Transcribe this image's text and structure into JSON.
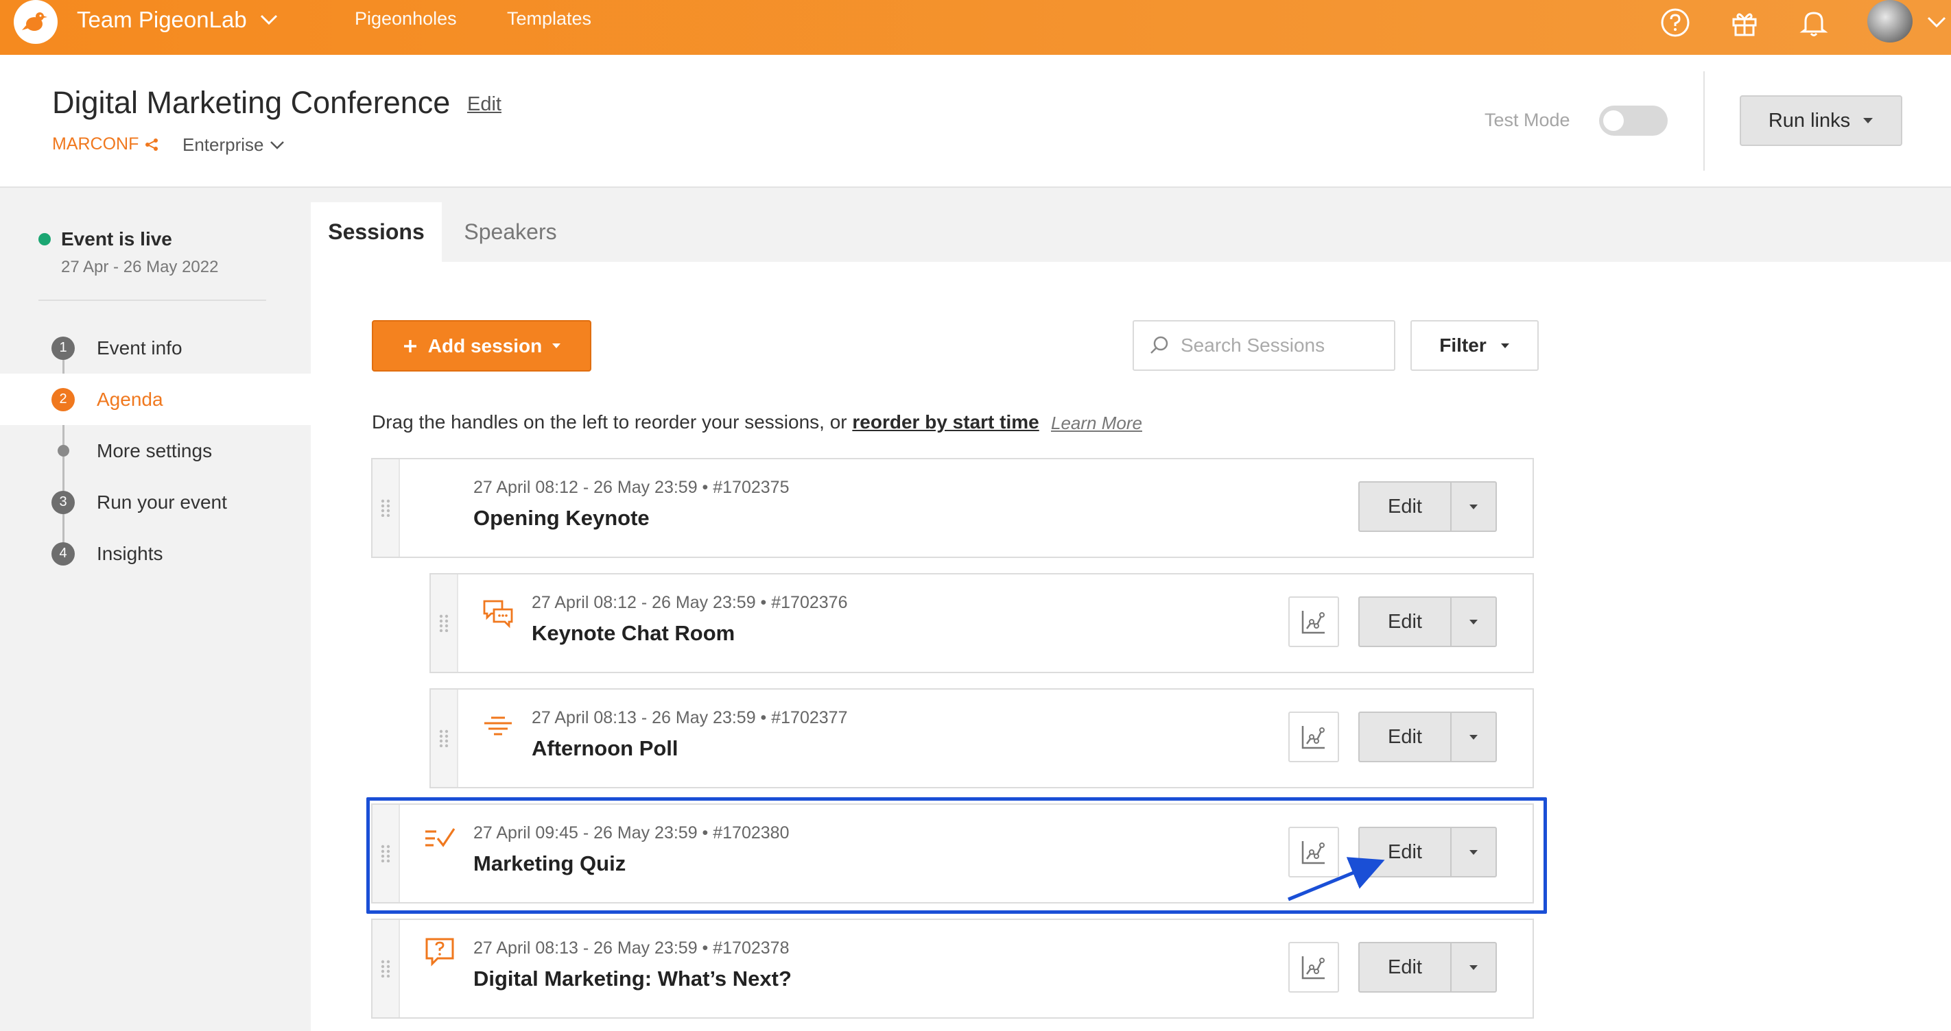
{
  "topbar": {
    "team_name": "Team PigeonLab",
    "nav": [
      "Pigeonholes",
      "Templates"
    ],
    "icons": [
      "help-icon",
      "gift-icon",
      "bell-icon"
    ]
  },
  "header": {
    "event_title": "Digital Marketing Conference",
    "edit_label": "Edit",
    "event_code": "MARCONF",
    "plan": "Enterprise",
    "test_mode_label": "Test Mode",
    "test_mode_on": false,
    "run_links_label": "Run links"
  },
  "sidebar": {
    "status": "Event is live",
    "dates": "27 Apr - 26 May 2022",
    "steps": [
      {
        "num": "1",
        "label": "Event info",
        "active": false
      },
      {
        "num": "2",
        "label": "Agenda",
        "active": true
      },
      {
        "num": "",
        "label": "More settings",
        "active": false
      },
      {
        "num": "3",
        "label": "Run your event",
        "active": false
      },
      {
        "num": "4",
        "label": "Insights",
        "active": false
      }
    ]
  },
  "tabs": [
    "Sessions",
    "Speakers"
  ],
  "toolbar": {
    "add_session": "Add session",
    "search_placeholder": "Search Sessions",
    "filter": "Filter"
  },
  "hint": {
    "text": "Drag the handles on the left to reorder your sessions, or ",
    "link": "reorder by start time",
    "learn_more": "Learn More"
  },
  "sessions": [
    {
      "meta": "27 April 08:12 - 26 May 23:59  •  #1702375",
      "name": "Opening Keynote",
      "icon": "",
      "edit": "Edit"
    },
    {
      "meta": "27 April 08:12 - 26 May 23:59  •  #1702376",
      "name": "Keynote Chat Room",
      "icon": "chat-icon",
      "edit": "Edit"
    },
    {
      "meta": "27 April 08:13 - 26 May 23:59  •  #1702377",
      "name": "Afternoon Poll",
      "icon": "poll-icon",
      "edit": "Edit"
    },
    {
      "meta": "27 April 09:45 - 26 May 23:59  •  #1702380",
      "name": "Marketing Quiz",
      "icon": "quiz-icon",
      "edit": "Edit"
    },
    {
      "meta": "27 April 08:13 - 26 May 23:59  •  #1702378",
      "name": "Digital Marketing: What’s Next?",
      "icon": "qna-icon",
      "edit": "Edit"
    }
  ],
  "colors": {
    "brand_orange": "#f4821f",
    "live_green": "#1ba672",
    "highlight_blue": "#1a4fd6"
  }
}
